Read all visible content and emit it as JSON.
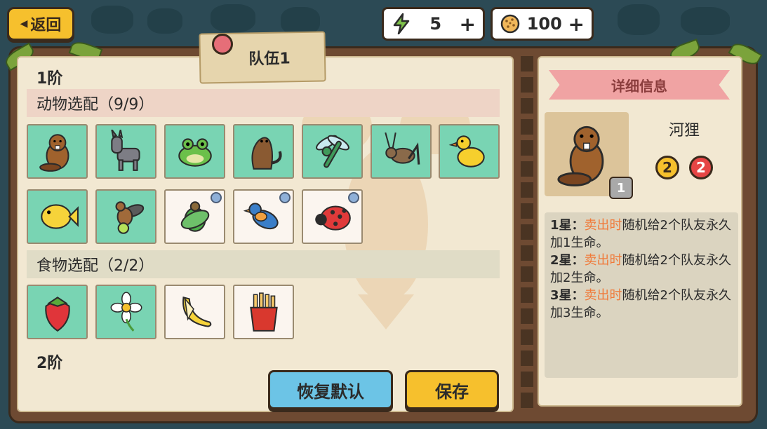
{
  "header": {
    "back_label": "返回",
    "energy_value": "5",
    "coin_value": "100",
    "plus_symbol": "+"
  },
  "team": {
    "tab_label": "队伍1",
    "tier1_label": "1阶",
    "tier2_label": "2阶",
    "animal_section_label": "动物选配（9/9）",
    "food_section_label": "食物选配（2/2）",
    "animals": [
      {
        "name": "beaver",
        "state": "owned"
      },
      {
        "name": "donkey",
        "state": "owned"
      },
      {
        "name": "frog",
        "state": "owned"
      },
      {
        "name": "otter",
        "state": "owned"
      },
      {
        "name": "dragonfly",
        "state": "owned"
      },
      {
        "name": "cricket",
        "state": "owned"
      },
      {
        "name": "duck",
        "state": "owned"
      },
      {
        "name": "fish",
        "state": "owned"
      },
      {
        "name": "firefly",
        "state": "owned"
      },
      {
        "name": "beetle",
        "state": "locked"
      },
      {
        "name": "bluebird",
        "state": "locked"
      },
      {
        "name": "ladybug",
        "state": "locked"
      }
    ],
    "foods": [
      {
        "name": "strawberry",
        "state": "owned"
      },
      {
        "name": "flower",
        "state": "owned"
      },
      {
        "name": "banana",
        "state": "locked"
      },
      {
        "name": "fries",
        "state": "locked"
      }
    ],
    "reset_label": "恢复默认",
    "save_label": "保存"
  },
  "detail": {
    "ribbon_label": "详细信息",
    "pet_name": "河狸",
    "level": "1",
    "attack": "2",
    "health": "2",
    "lines": [
      {
        "star": "1星：",
        "keyword": "卖出时",
        "text": "随机给2个队友永久加1生命。"
      },
      {
        "star": "2星：",
        "keyword": "卖出时",
        "text": "随机给2个队友永久加2生命。"
      },
      {
        "star": "3星：",
        "keyword": "卖出时",
        "text": "随机给2个队友永久加3生命。"
      }
    ]
  },
  "colors": {
    "owned_slot": "#79d4b3",
    "locked_slot": "#fbf5ef",
    "accent_yellow": "#f6c02d",
    "accent_blue": "#6cc4e6",
    "keyword_orange": "#f07a3a"
  }
}
